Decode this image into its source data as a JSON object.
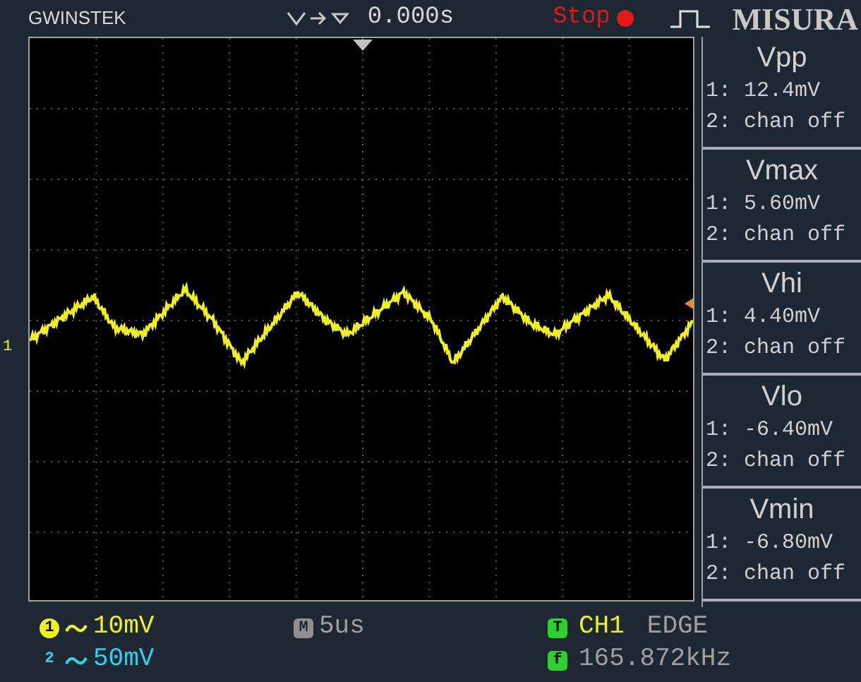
{
  "header": {
    "brand": "GWINSTEK",
    "trigger_delay": "0.000s",
    "run_state": "Stop",
    "title": "MISURA"
  },
  "display": {
    "channel_marker": "1"
  },
  "measurements": [
    {
      "name": "Vpp",
      "ch1": "1: 12.4mV",
      "ch2": "2: chan off"
    },
    {
      "name": "Vmax",
      "ch1": "1: 5.60mV",
      "ch2": "2: chan off"
    },
    {
      "name": "Vhi",
      "ch1": "1: 4.40mV",
      "ch2": "2: chan off"
    },
    {
      "name": "Vlo",
      "ch1": "1: -6.40mV",
      "ch2": "2: chan off"
    },
    {
      "name": "Vmin",
      "ch1": "1: -6.80mV",
      "ch2": "2: chan off"
    }
  ],
  "footer": {
    "ch1_badge": "1",
    "ch1_scale": "10mV",
    "ch2_badge": "2",
    "ch2_scale": "50mV",
    "timebase_badge": "M",
    "timebase": "5us",
    "trigger_badge": "T",
    "trigger_source": "CH1",
    "trigger_type": "EDGE",
    "frequency_badge": "f",
    "frequency": "165.872kHz"
  }
}
